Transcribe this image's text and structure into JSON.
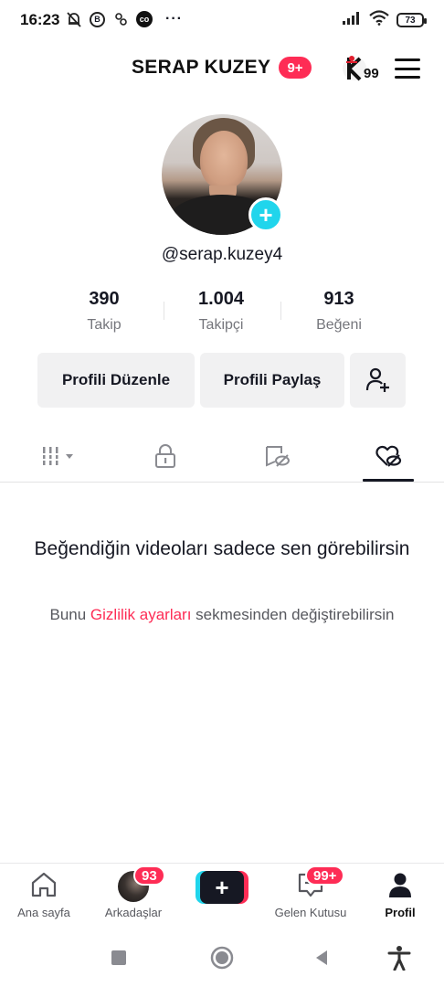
{
  "status_bar": {
    "time": "16:23",
    "b_icon_letter": "B",
    "co_icon_text": "co",
    "more_dots": "···",
    "battery": "73"
  },
  "header": {
    "title": "SERAP KUZEY",
    "badge": "9+",
    "logo_subscript": "99"
  },
  "profile": {
    "handle": "@serap.kuzey4",
    "add_button_symbol": "+",
    "stats": [
      {
        "value": "390",
        "label": "Takip"
      },
      {
        "value": "1.004",
        "label": "Takipçi"
      },
      {
        "value": "913",
        "label": "Beğeni"
      }
    ],
    "buttons": {
      "edit": "Profili Düzenle",
      "share": "Profili Paylaş"
    }
  },
  "tabs": [
    {
      "icon": "grid-icon",
      "active": false
    },
    {
      "icon": "lock-icon",
      "active": false
    },
    {
      "icon": "repost-hidden-icon",
      "active": false
    },
    {
      "icon": "liked-hidden-icon",
      "active": true
    }
  ],
  "empty_state": {
    "title": "Beğendiğin videoları sadece sen görebilirsin",
    "sub_before": "Bunu ",
    "sub_link": "Gizlilik ayarları",
    "sub_after": " sekmesinden değiştirebilirsin"
  },
  "bottom_nav": {
    "home": "Ana sayfa",
    "friends": "Arkadaşlar",
    "friends_badge": "93",
    "create_symbol": "+",
    "inbox": "Gelen Kutusu",
    "inbox_badge": "99+",
    "profile": "Profil"
  },
  "colors": {
    "accent_red": "#fe2c55",
    "accent_cyan": "#20d5ec",
    "text_primary": "#161823",
    "text_secondary": "#75767c"
  }
}
